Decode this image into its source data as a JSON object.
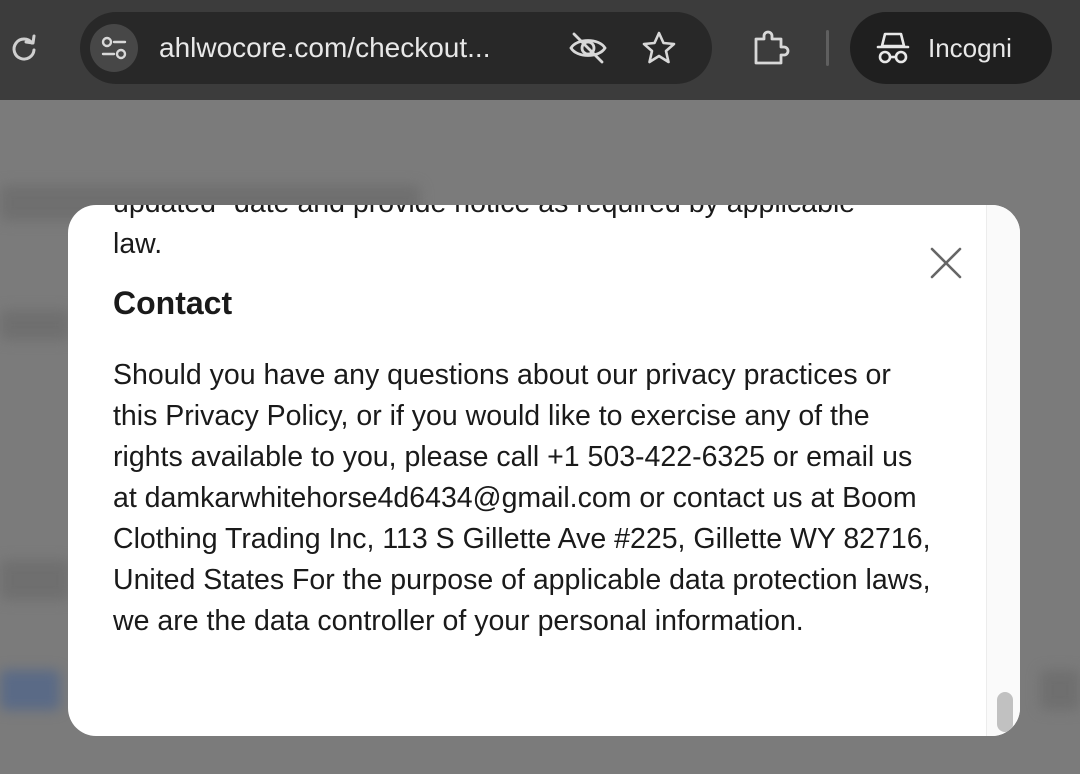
{
  "browser": {
    "url": "ahlwocore.com/checkout...",
    "profile_label": "Incogni",
    "icons": [
      "reload-icon",
      "site-info-icon",
      "eye-off-icon",
      "star-icon",
      "extensions-icon",
      "incognito-icon"
    ]
  },
  "modal": {
    "cut_line": "updated\" date and provide notice as required by applicable",
    "intro_tail": "law.",
    "heading": "Contact",
    "body": "Should you have any questions about our privacy practices or this Privacy Policy, or if you would like to exercise any of the rights available to you, please call +1 503-422-6325 or email us at damkarwhitehorse4d6434@gmail.com or contact us at Boom Clothing Trading Inc, 113 S Gillette Ave #225, Gillette WY 82716, United States For the purpose of applicable data protection laws, we are the data controller of your personal information.",
    "close_icon": "close-icon"
  },
  "colors": {
    "chrome_bg": "#3c3c3c",
    "omnibox_bg": "#282828",
    "backdrop": "#7a7a7a",
    "modal_bg": "#ffffff",
    "text": "#1a1a1a"
  }
}
